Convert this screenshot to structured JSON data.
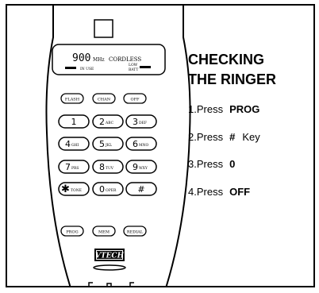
{
  "phone": {
    "display_model": "900",
    "display_unit": "MHz",
    "display_label": "CORDLESS",
    "in_use": "IN USE",
    "low_batt_1": "LOW",
    "low_batt_2": "BATT",
    "top_keys": [
      {
        "label": "FLASH",
        "name": "flash-key"
      },
      {
        "label": "CHAN",
        "name": "channel-key"
      },
      {
        "label": "OFF",
        "name": "off-key"
      }
    ],
    "keypad": [
      {
        "digit": "1",
        "letters": "",
        "name": "key-1"
      },
      {
        "digit": "2",
        "letters": "ABC",
        "name": "key-2"
      },
      {
        "digit": "3",
        "letters": "DEF",
        "name": "key-3"
      },
      {
        "digit": "4",
        "letters": "GHI",
        "name": "key-4"
      },
      {
        "digit": "5",
        "letters": "JKL",
        "name": "key-5"
      },
      {
        "digit": "6",
        "letters": "MNO",
        "name": "key-6"
      },
      {
        "digit": "7",
        "letters": "PRS",
        "name": "key-7"
      },
      {
        "digit": "8",
        "letters": "TUV",
        "name": "key-8"
      },
      {
        "digit": "9",
        "letters": "WXY",
        "name": "key-9"
      },
      {
        "digit": "✱",
        "letters": "TONE",
        "name": "key-star"
      },
      {
        "digit": "0",
        "letters": "OPER",
        "name": "key-0"
      },
      {
        "digit": "#",
        "letters": "",
        "name": "key-pound"
      }
    ],
    "bottom_keys": [
      {
        "label": "PROG",
        "name": "prog-key"
      },
      {
        "label": "MEM",
        "name": "mem-key"
      },
      {
        "label": "REDIAL",
        "name": "redial-key"
      }
    ],
    "brand": "VTECH"
  },
  "instructions": {
    "title_line1": "CHECKING",
    "title_line2": "THE RINGER",
    "steps": [
      {
        "prefix": "1.Press",
        "key": "PROG",
        "suffix": ""
      },
      {
        "prefix": "2.Press",
        "key": "#",
        "suffix": "Key"
      },
      {
        "prefix": "3.Press",
        "key": "0",
        "suffix": ""
      },
      {
        "prefix": "4.Press",
        "key": "OFF",
        "suffix": ""
      }
    ]
  }
}
